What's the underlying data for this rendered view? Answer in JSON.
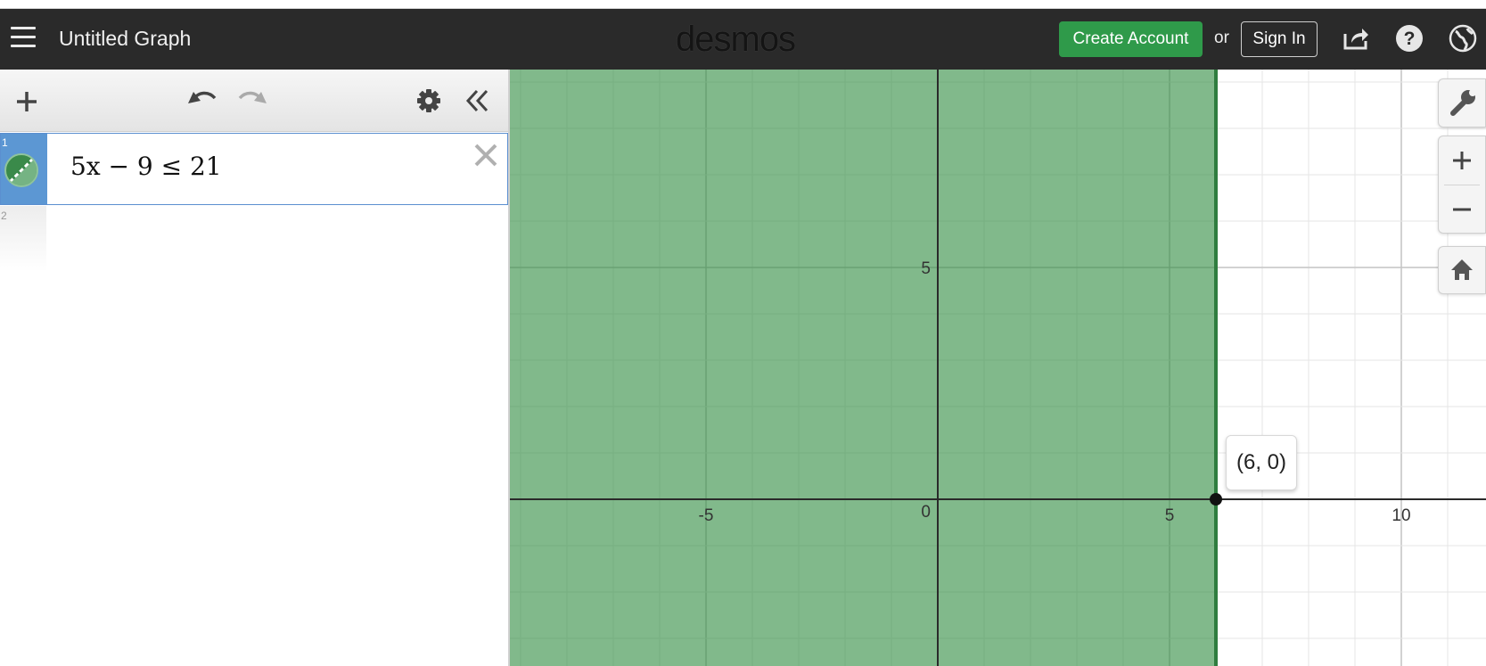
{
  "header": {
    "title": "Untitled Graph",
    "logo": "desmos",
    "create_account": "Create Account",
    "or": "or",
    "sign_in": "Sign In",
    "icons": [
      "menu-icon",
      "share-icon",
      "help-icon",
      "globe-icon"
    ]
  },
  "expressions": [
    {
      "number": "1",
      "latex": "5x − 9 ≤ 21",
      "color": "#2d7a3a"
    },
    {
      "number": "2",
      "latex": ""
    }
  ],
  "graph": {
    "x_ticks": [
      {
        "value": -5,
        "label": "-5"
      },
      {
        "value": 5,
        "label": "5"
      },
      {
        "value": 10,
        "label": "10"
      }
    ],
    "y_ticks": [
      {
        "value": 5,
        "label": "5"
      }
    ],
    "origin_label": "0",
    "point_label": "(6, 0)",
    "shade_color": "#2d8a3e",
    "boundary_x": 6
  },
  "colors": {
    "header_bg": "#2a2a2a",
    "create_account_bg": "#2f9a4a",
    "selected_gutter": "#5c97d3"
  }
}
